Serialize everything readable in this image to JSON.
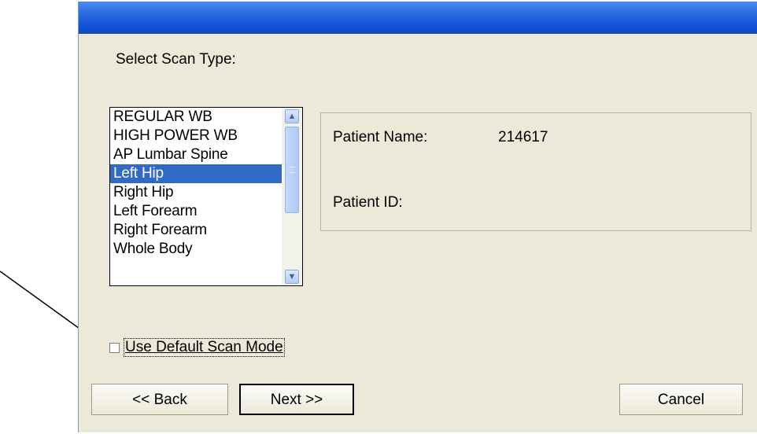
{
  "dialog": {
    "select_label": "Select Scan Type:",
    "scan_types": [
      "REGULAR WB",
      "HIGH POWER WB",
      "AP Lumbar Spine",
      "Left Hip",
      "Right Hip",
      "Left Forearm",
      "Right Forearm",
      "Whole Body"
    ],
    "selected_scan_type": "Left Hip",
    "patient": {
      "name_label": "Patient Name:",
      "name_value": "214617",
      "id_label": "Patient ID:"
    },
    "use_default_label": "Use Default Scan Mode",
    "use_default_checked": false,
    "buttons": {
      "back": "<< Back",
      "next": "Next >>",
      "cancel": "Cancel"
    }
  },
  "colors": {
    "dialog_bg": "#ece9d8",
    "title_bar": "#1656d8",
    "selection": "#316ac5"
  },
  "icons": {
    "scroll_up": "chevron-up-icon",
    "scroll_down": "chevron-down-icon"
  }
}
